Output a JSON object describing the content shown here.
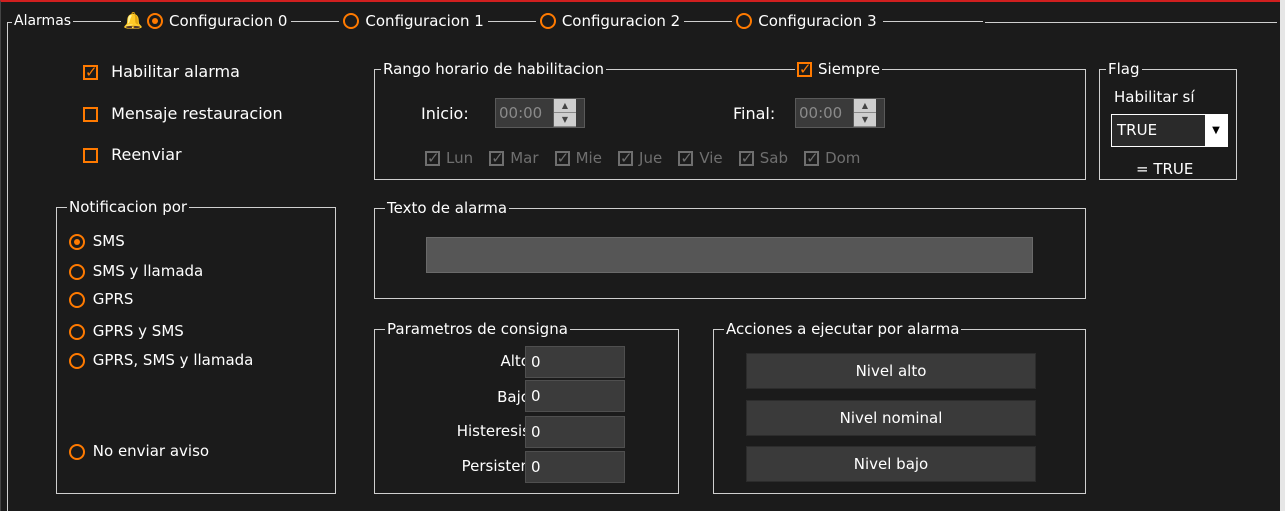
{
  "tabs": {
    "alarmas_label": "Alarmas",
    "configs": [
      {
        "label": "Configuracion 0",
        "selected": true
      },
      {
        "label": "Configuracion 1",
        "selected": false
      },
      {
        "label": "Configuracion 2",
        "selected": false
      },
      {
        "label": "Configuracion 3",
        "selected": false
      }
    ]
  },
  "options": {
    "habilitar_alarma": {
      "label": "Habilitar alarma",
      "checked": true
    },
    "mensaje_restauracion": {
      "label": "Mensaje restauracion",
      "checked": false
    },
    "reenviar": {
      "label": "Reenviar",
      "checked": false
    }
  },
  "rango": {
    "title": "Rango horario de habilitacion",
    "siempre_label": "Siempre",
    "inicio_label": "Inicio:",
    "inicio_value": "00:00",
    "final_label": "Final:",
    "final_value": "00:00",
    "days": [
      "Lun",
      "Mar",
      "Mie",
      "Jue",
      "Vie",
      "Sab",
      "Dom"
    ]
  },
  "flag": {
    "title": "Flag",
    "habilitar_label": "Habilitar sí",
    "select_value": "TRUE",
    "result": "= TRUE"
  },
  "notificacion": {
    "title": "Notificacion por",
    "items": [
      "SMS",
      "SMS y llamada",
      "GPRS",
      "GPRS y SMS",
      "GPRS, SMS y llamada"
    ],
    "no_enviar": "No enviar aviso"
  },
  "texto": {
    "title": "Texto de alarma",
    "value": ""
  },
  "parametros": {
    "title": "Parametros de consigna",
    "rows": [
      {
        "label": "Alto:",
        "value": "0"
      },
      {
        "label": "Bajo:",
        "value": "0"
      },
      {
        "label": "Histeresis:",
        "value": "0"
      },
      {
        "label": "Persisten:",
        "value": "0"
      }
    ]
  },
  "acciones": {
    "title": "Acciones a ejecutar por alarma",
    "buttons": [
      "Nivel alto",
      "Nivel nominal",
      "Nivel bajo"
    ]
  },
  "colors": {
    "accent": "#ff7a00",
    "background": "#1b1b1b",
    "top_border": "#d01f1f"
  },
  "icons": {
    "bell": "bell-icon"
  }
}
